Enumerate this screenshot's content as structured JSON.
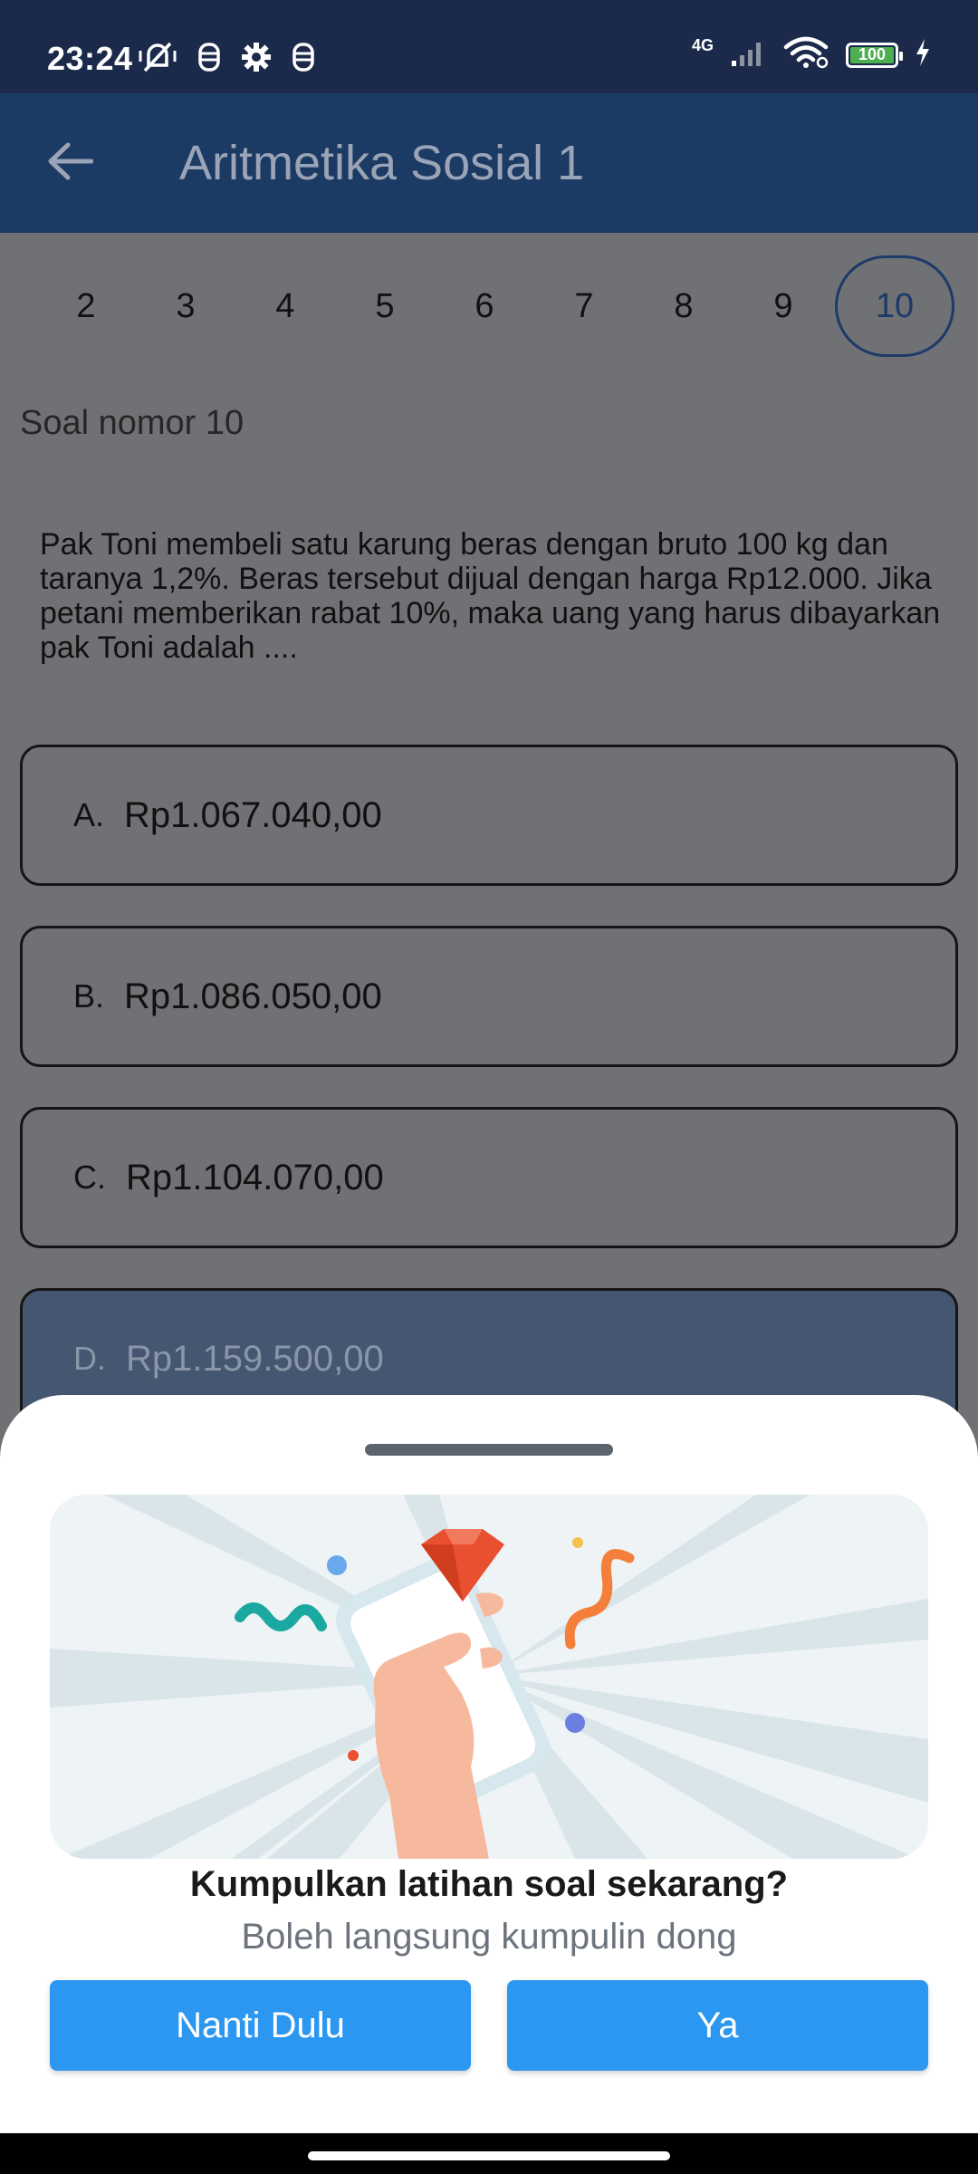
{
  "status_bar": {
    "time": "23:24",
    "network": "4G",
    "battery": "100",
    "icons": [
      "mute-vibrate-icon",
      "accessibility-icon",
      "settings-icon",
      "accessibility-icon",
      "signal-icon",
      "wifi-icon",
      "battery-icon",
      "charging-icon"
    ]
  },
  "app_bar": {
    "title": "Aritmetika Sosial 1",
    "back_icon": "arrow-left-icon"
  },
  "question_nav": {
    "numbers": [
      "2",
      "3",
      "4",
      "5",
      "6",
      "7",
      "8",
      "9",
      "10"
    ],
    "active": "10"
  },
  "question": {
    "label": "Soal nomor 10",
    "text": "Pak Toni membeli satu karung beras dengan bruto 100 kg dan taranya 1,2%. Beras tersebut dijual dengan harga Rp12.000. Jika petani memberikan rabat 10%, maka uang yang harus dibayarkan pak Toni adalah ....",
    "options": [
      {
        "letter": "A.",
        "text": "Rp1.067.040,00"
      },
      {
        "letter": "B.",
        "text": "Rp1.086.050,00"
      },
      {
        "letter": "C.",
        "text": "Rp1.104.070,00"
      },
      {
        "letter": "D.",
        "text": "Rp1.159.500,00"
      }
    ],
    "selected": "D."
  },
  "sheet": {
    "title": "Kumpulkan latihan soal sekarang?",
    "subtitle": "Boleh langsung kumpulin dong",
    "later_label": "Nanti Dulu",
    "yes_label": "Ya"
  },
  "colors": {
    "status_bar": "#1b2a4a",
    "app_bar": "#1b3a64",
    "button": "#2c97f0",
    "scrim_bg": "#6f7174",
    "selected_option": "#445670"
  }
}
